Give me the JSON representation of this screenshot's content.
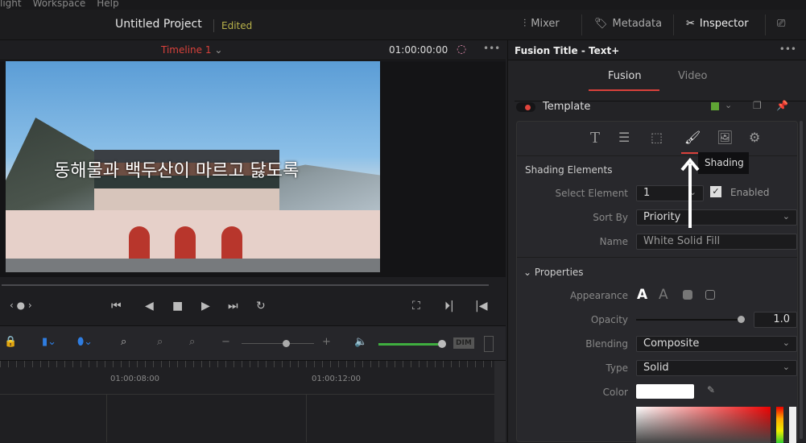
{
  "menu": [
    "light",
    "Workspace",
    "Help"
  ],
  "header": {
    "project": "Untitled Project",
    "status": "Edited",
    "mixer": "Mixer",
    "metadata": "Metadata",
    "inspector": "Inspector"
  },
  "viewer": {
    "timeline": "Timeline 1",
    "timecode": "01:00:00:00",
    "subtitle": "동해물과 백두산이 마르고 닳도록"
  },
  "toolbar": {
    "dim": "DIM"
  },
  "ruler": {
    "marks": [
      "01:00:08:00",
      "01:00:12:00"
    ]
  },
  "inspector": {
    "title": "Fusion Title - Text+",
    "tabs": [
      "Fusion",
      "Video"
    ],
    "section": "Template",
    "tooltip": "Shading",
    "shading": {
      "heading": "Shading Elements",
      "select_label": "Select Element",
      "select_value": "1",
      "enabled_label": "Enabled",
      "sort_label": "Sort By",
      "sort_value": "Priority",
      "name_label": "Name",
      "name_value": "White Solid Fill"
    },
    "properties": {
      "heading": "Properties",
      "appearance_label": "Appearance",
      "opacity_label": "Opacity",
      "opacity_value": "1.0",
      "opacity": 1.0,
      "blending_label": "Blending",
      "blending_value": "Composite",
      "type_label": "Type",
      "type_value": "Solid",
      "color_label": "Color",
      "color_value": "#ffffff"
    }
  },
  "colors": {
    "accent": "#d8413b",
    "edited": "#b9b24a",
    "volume": "#3fae3f"
  }
}
